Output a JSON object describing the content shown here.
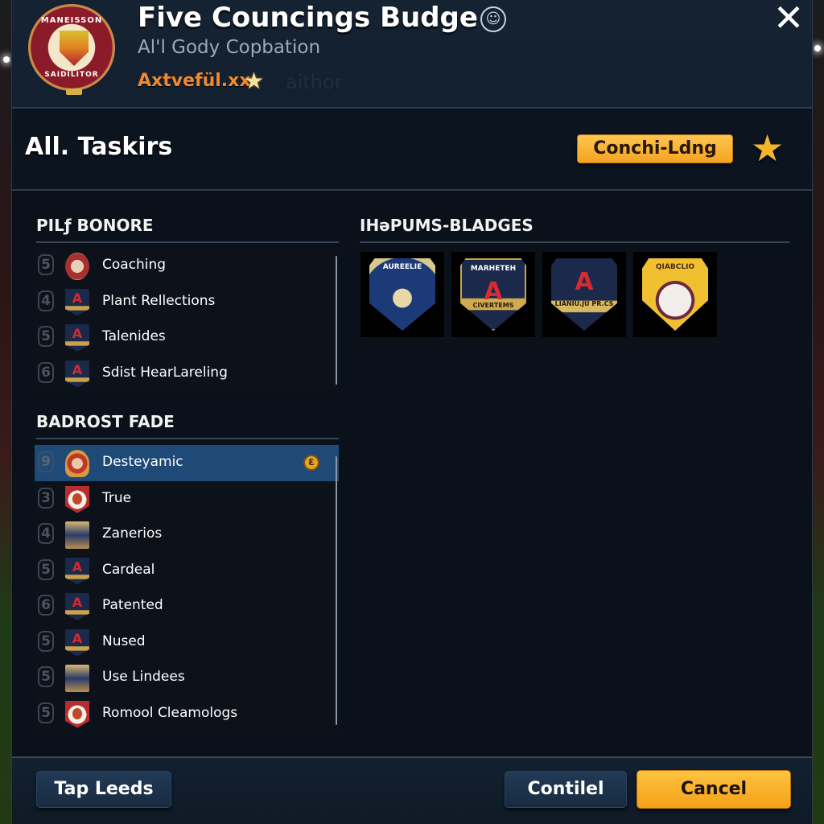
{
  "header": {
    "title": "Five Councling Budge",
    "title_display": "Five Councings Budge",
    "subtitle": "Al'l Gody Copbation",
    "user_tag": "Axtvefül.xx",
    "ghost_text": "aithor",
    "crest": {
      "top_text": "MANEISSON",
      "bottom_text": "SAIDILITOR"
    },
    "info_icon": "person-badge-icon",
    "close_icon": "close-icon"
  },
  "section": {
    "title": "All. Taskirs",
    "coaching_button": "Conchi-Ldng",
    "favorite_icon": "star-icon"
  },
  "left_column": {
    "group1": {
      "heading": "PILƒ BONORE",
      "items": [
        {
          "rank": "5",
          "label": "Coaching",
          "badge": "round"
        },
        {
          "rank": "4",
          "label": "Plant Rellections",
          "badge": "A"
        },
        {
          "rank": "5",
          "label": "Talenides",
          "badge": "A"
        },
        {
          "rank": "6",
          "label": "Sdist HearLareling",
          "badge": "A"
        }
      ]
    },
    "group2": {
      "heading": "BADROST FADE",
      "items": [
        {
          "rank": "9",
          "label": "Desteуamic",
          "badge": "gold",
          "selected": true,
          "indicator": "Ɛ"
        },
        {
          "rank": "3",
          "label": "True",
          "badge": "shield"
        },
        {
          "rank": "4",
          "label": "Zanerios",
          "badge": "crest"
        },
        {
          "rank": "5",
          "label": "Cardeal",
          "badge": "A"
        },
        {
          "rank": "6",
          "label": "Patented",
          "badge": "A"
        },
        {
          "rank": "5",
          "label": "Nused",
          "badge": "A"
        },
        {
          "rank": "5",
          "label": "Use Lindees",
          "badge": "crest"
        },
        {
          "rank": "5",
          "label": "Romool Cleamologs",
          "badge": "shield"
        }
      ]
    }
  },
  "right_column": {
    "heading": "IHəPUMS-BLADGES",
    "badges": [
      {
        "caption": "AUREELIE",
        "style": "blue-eagle"
      },
      {
        "caption": "MARHETEH",
        "letter": "A",
        "band": "CIVERTEMS"
      },
      {
        "caption": "",
        "letter": "A",
        "band": "LIANIU.JU PR.CS"
      },
      {
        "caption": "QIABCLIO",
        "style": "gold-shield"
      }
    ]
  },
  "footer": {
    "left_button": "Tap Leeds",
    "continue_button": "Contilel",
    "cancel_button": "Cancel"
  },
  "colors": {
    "accent_gold": "#f4a422",
    "selected_row": "#1f4a78",
    "panel_bg": "#0b111a",
    "user_tag": "#f08a30"
  }
}
